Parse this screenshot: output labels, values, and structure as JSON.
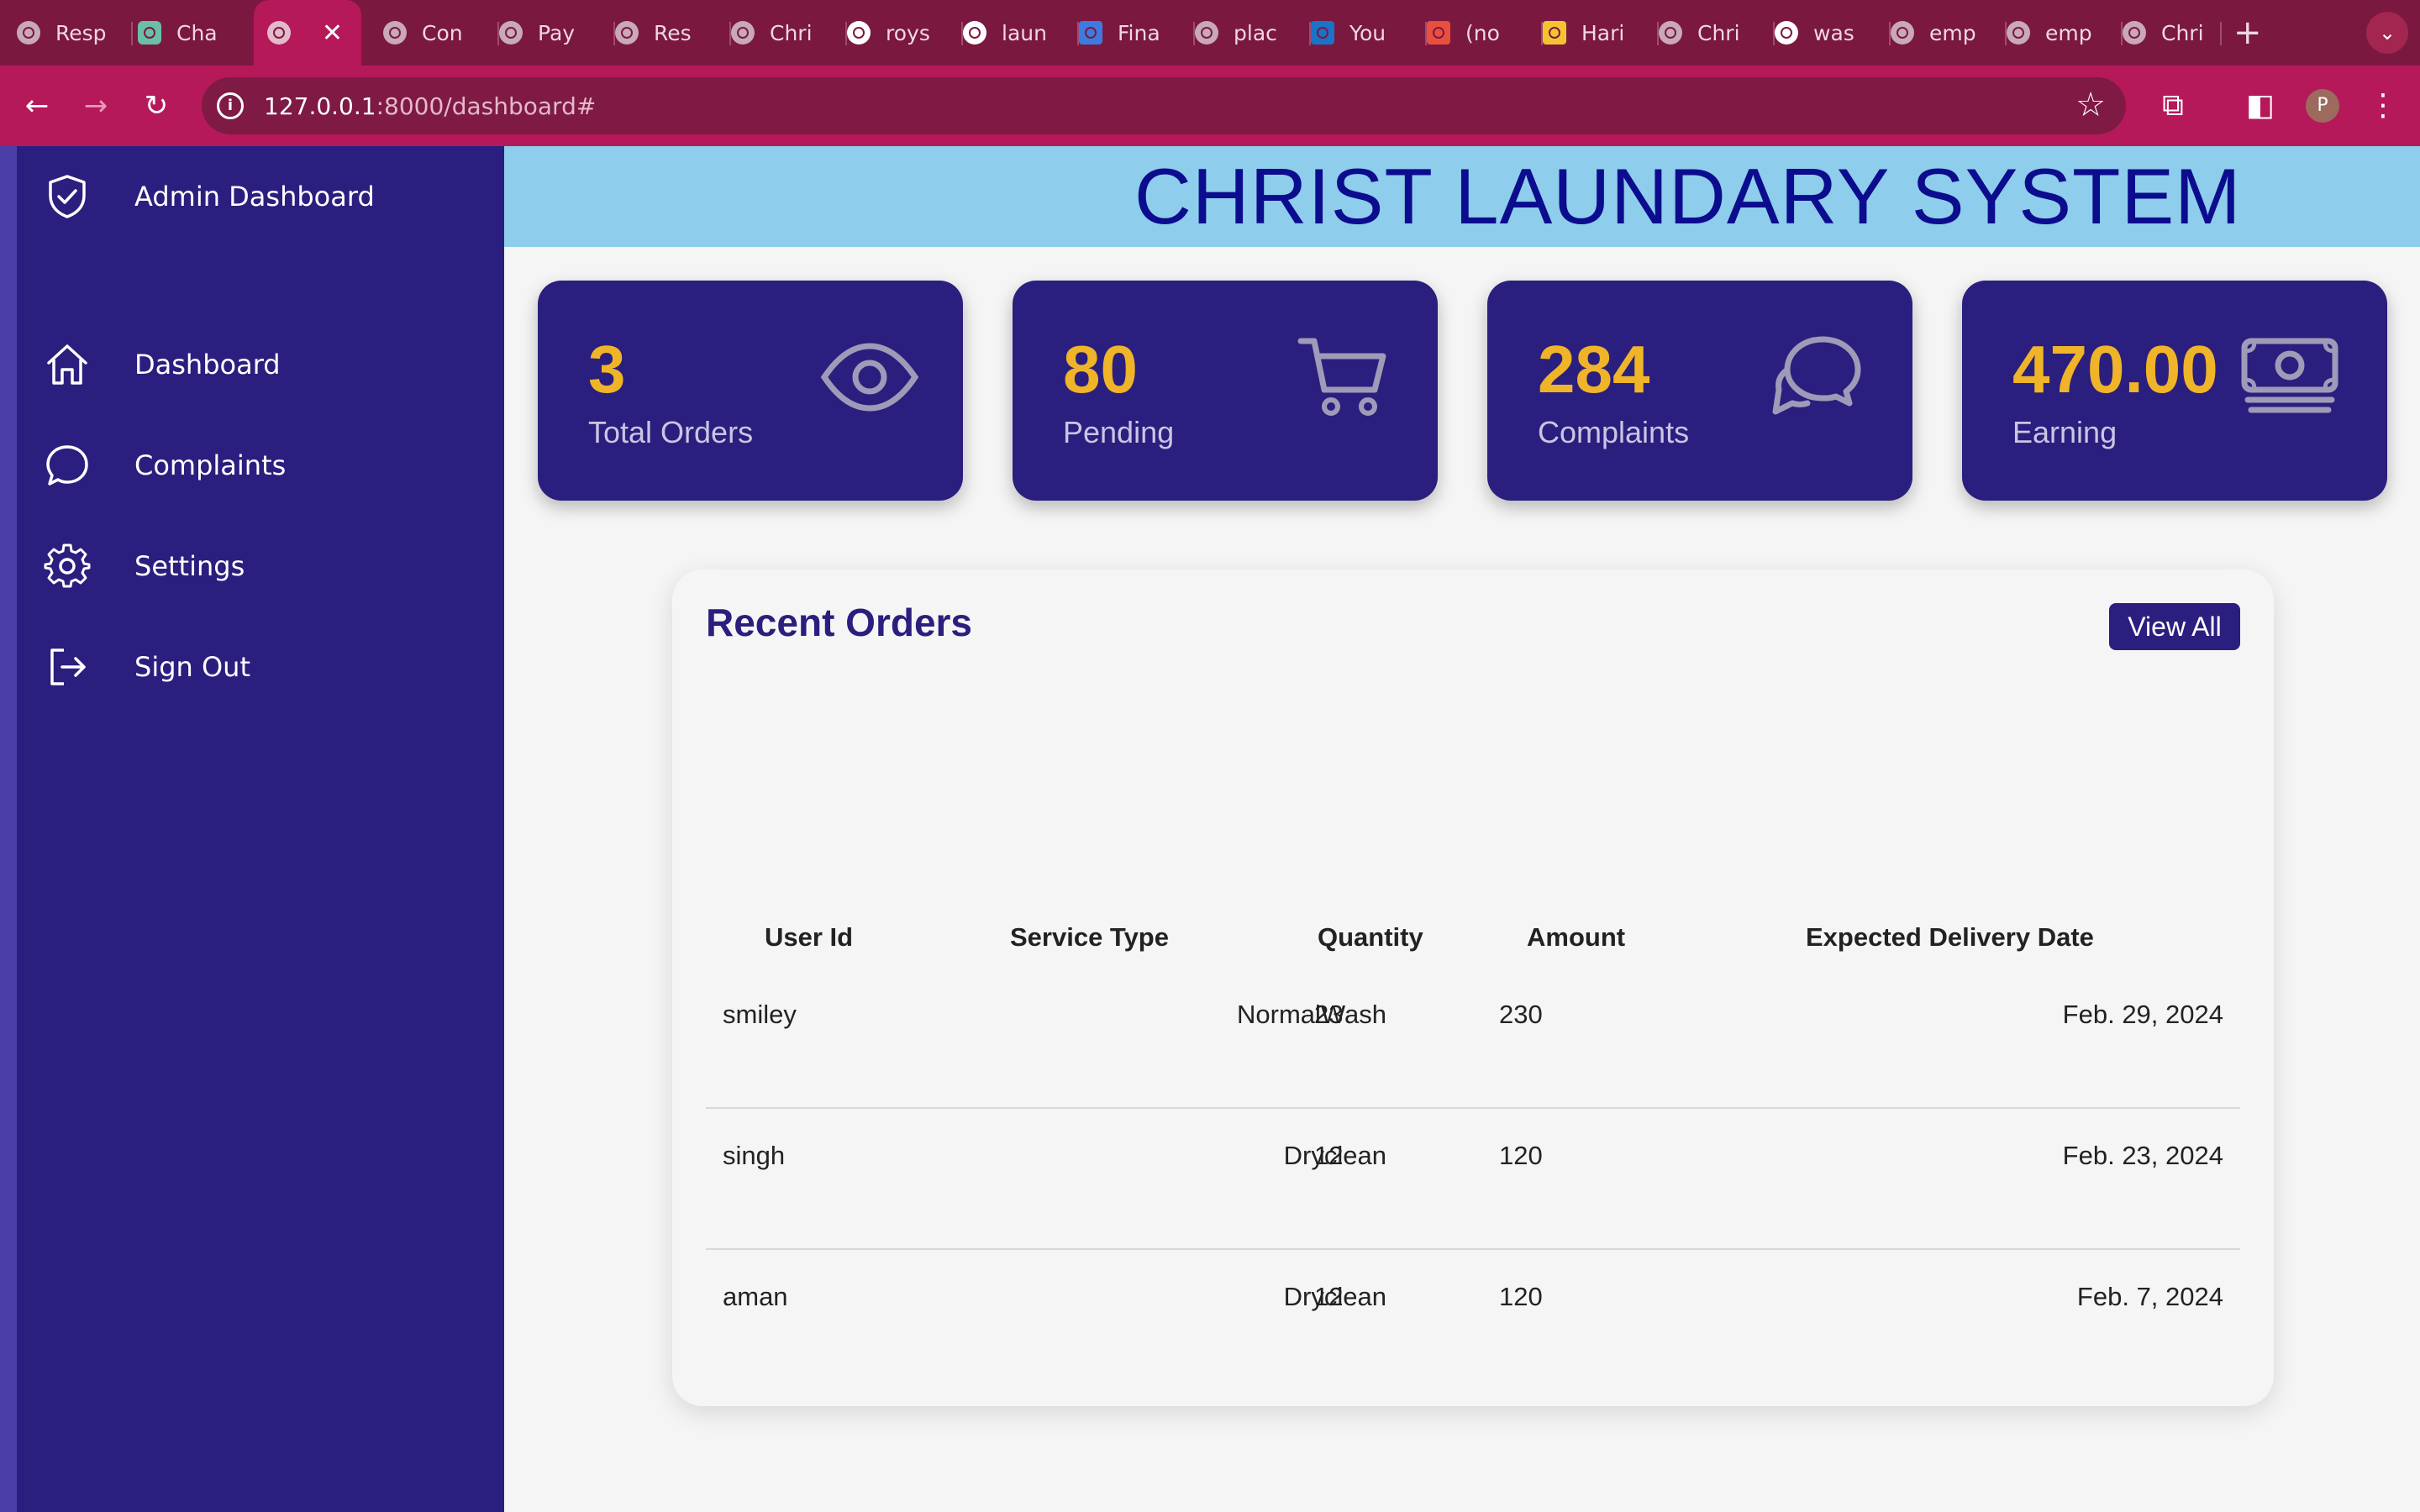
{
  "browser": {
    "tabs": [
      {
        "title": "Resp"
      },
      {
        "title": "Cha"
      },
      {
        "title": ""
      },
      {
        "title": "Con"
      },
      {
        "title": "Pay"
      },
      {
        "title": "Res"
      },
      {
        "title": "Chri"
      },
      {
        "title": "roys"
      },
      {
        "title": "laun"
      },
      {
        "title": "Fina"
      },
      {
        "title": "plac"
      },
      {
        "title": "You"
      },
      {
        "title": "(no"
      },
      {
        "title": "Hari"
      },
      {
        "title": "Chri"
      },
      {
        "title": "was"
      },
      {
        "title": "emp"
      },
      {
        "title": "emp"
      },
      {
        "title": "Chri"
      }
    ],
    "url_host": "127.0.0.1",
    "url_path": ":8000/dashboard#",
    "profile_initial": "P"
  },
  "sidebar": {
    "brand": "Admin Dashboard",
    "items": [
      {
        "label": "Dashboard",
        "icon": "home-icon"
      },
      {
        "label": "Complaints",
        "icon": "chat-bubble-icon"
      },
      {
        "label": "Settings",
        "icon": "gear-icon"
      },
      {
        "label": "Sign Out",
        "icon": "sign-out-icon"
      }
    ]
  },
  "header": {
    "title": "CHRIST LAUNDARY SYSTEM"
  },
  "cards": [
    {
      "value": "3",
      "label": "Total Orders",
      "icon": "eye-icon"
    },
    {
      "value": "80",
      "label": "Pending",
      "icon": "cart-icon"
    },
    {
      "value": "284",
      "label": "Complaints",
      "icon": "chat-bubbles-icon"
    },
    {
      "value": "470.00",
      "label": "Earning",
      "icon": "money-icon"
    }
  ],
  "recent_orders": {
    "title": "Recent Orders",
    "view_all": "View All",
    "columns": [
      "User Id",
      "Service Type",
      "Quantity",
      "Amount",
      "Expected Delivery Date"
    ],
    "rows": [
      [
        "smiley",
        "NormalWash",
        "23",
        "230",
        "Feb. 29, 2024"
      ],
      [
        "singh",
        "Dryclean",
        "12",
        "120",
        "Feb. 23, 2024"
      ],
      [
        "aman",
        "Dryclean",
        "12",
        "120",
        "Feb. 7, 2024"
      ]
    ]
  },
  "colors": {
    "sidebar": "#2a1f7e",
    "header": "#8ecdeb",
    "card_number": "#f0b428",
    "browser_frame": "#b5195a"
  }
}
